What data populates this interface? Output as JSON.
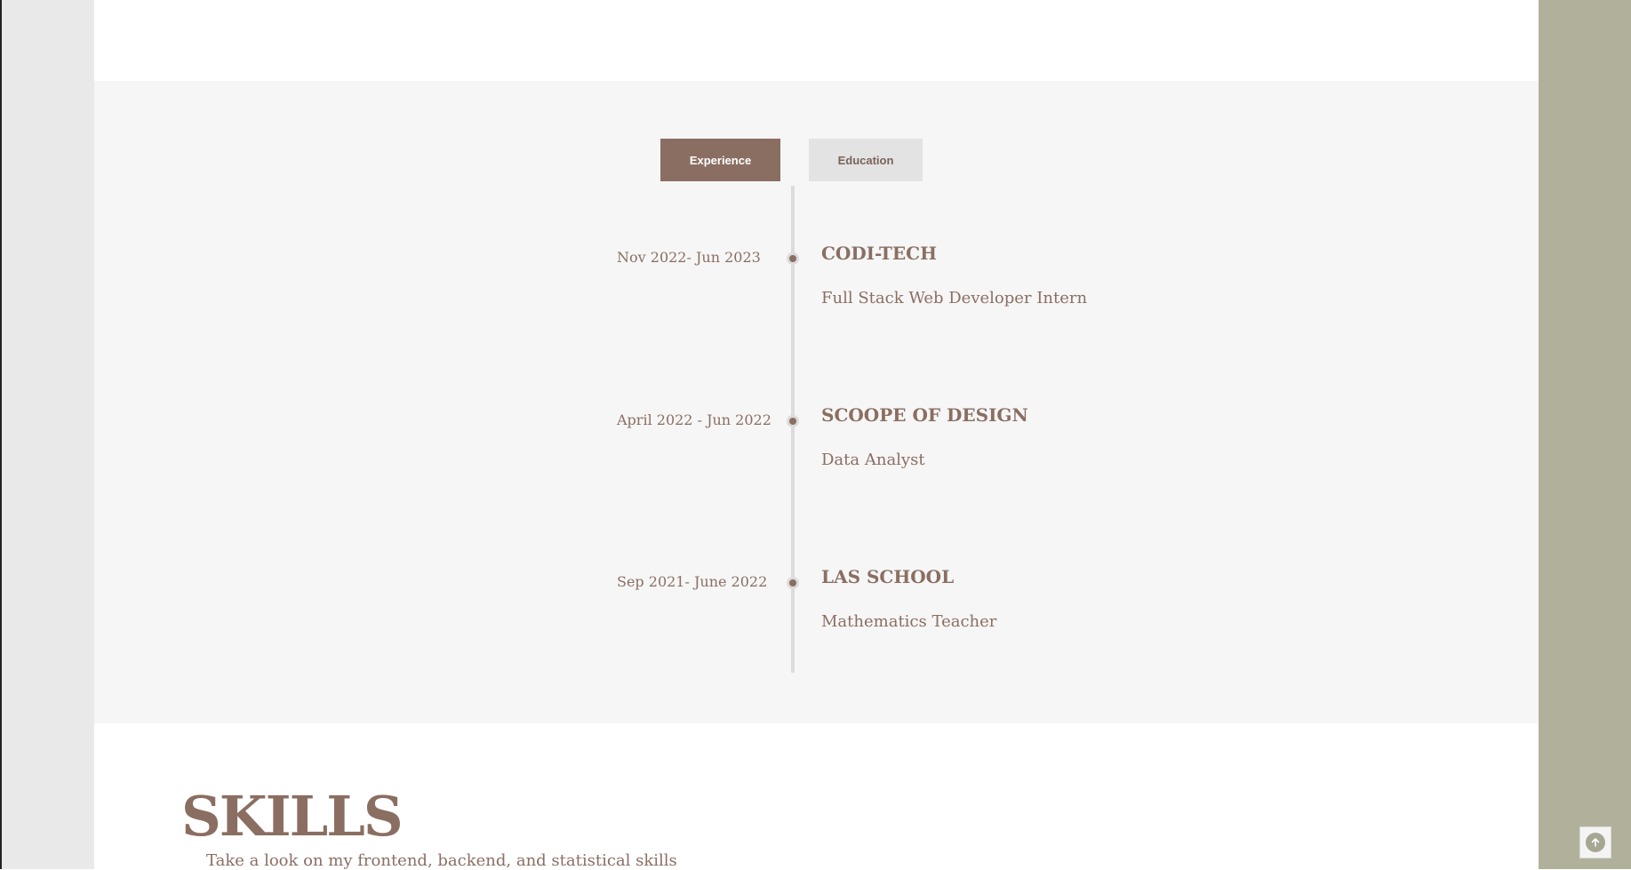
{
  "tabs": {
    "experience": "Experience",
    "education": "Education"
  },
  "timeline": [
    {
      "date": "Nov 2022- Jun 2023",
      "company": "CODI-TECH",
      "role": "Full Stack Web Developer Intern"
    },
    {
      "date": "April 2022 - Jun 2022",
      "company": "SCOOPE OF DESIGN",
      "role": "Data Analyst"
    },
    {
      "date": "Sep 2021- June 2022",
      "company": "LAS SCHOOL",
      "role": "Mathematics Teacher"
    }
  ],
  "skills": {
    "title": "SKILLS",
    "subtitle": "Take a look on my frontend, backend, and statistical skills"
  },
  "icons": {
    "scroll_top": "arrow-up-circle-icon"
  },
  "colors": {
    "accent": "#8b6e62",
    "side_panel": "#b1b19b",
    "section_bg": "#f6f6f6"
  }
}
